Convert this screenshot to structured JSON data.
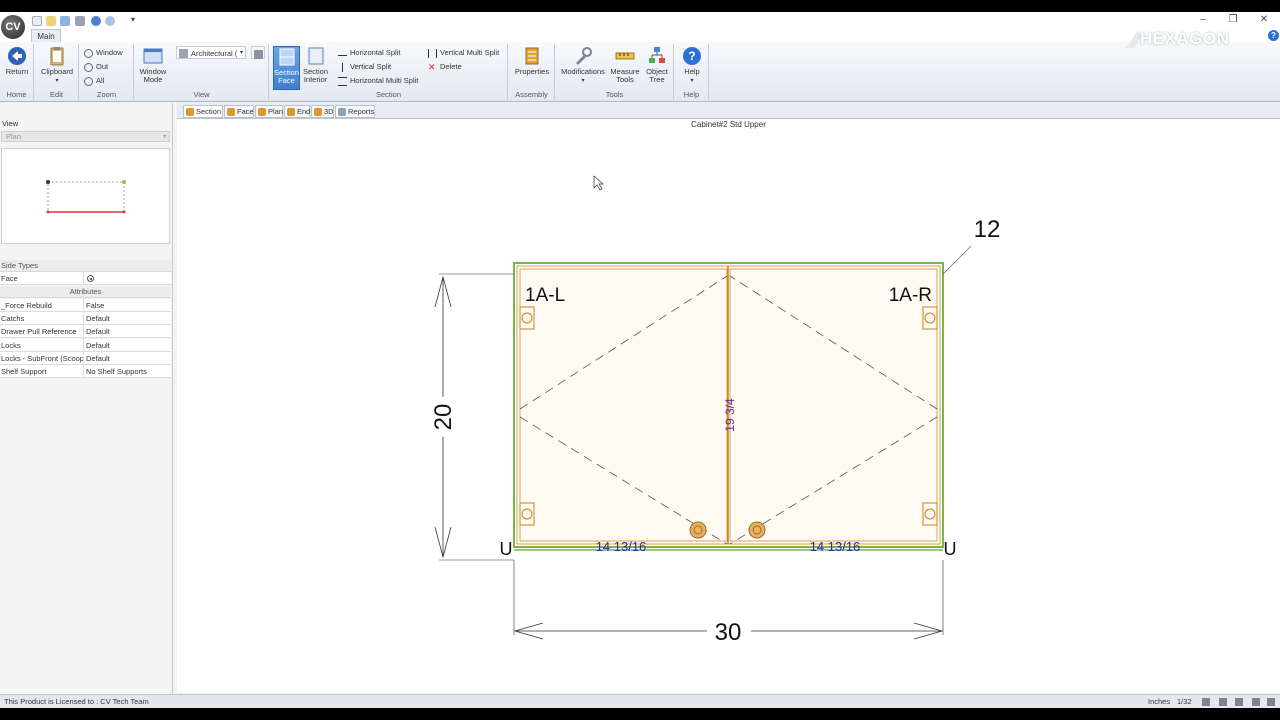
{
  "app": {
    "orb_label": "CV",
    "brand": "HEXAGON",
    "main_tab": "Main"
  },
  "ribbon": {
    "groups": {
      "home": "Home",
      "edit": "Edit",
      "zoom": "Zoom",
      "view": "View",
      "section": "Section",
      "assembly": "Assembly",
      "tools": "Tools",
      "help": "Help"
    },
    "buttons": {
      "return": "Return",
      "clipboard": "Clipboard",
      "zoom_window": "Window",
      "zoom_out": "Out",
      "zoom_all": "All",
      "window_mode_1": "Window",
      "window_mode_2": "Mode",
      "view_style": "Architectural (",
      "section_face_1": "Section",
      "section_face_2": "Face",
      "section_interior_1": "Section",
      "section_interior_2": "Interior",
      "horizontal_split": "Horizontal Split",
      "vertical_split": "Vertical Split",
      "horizontal_multi_split": "Horizontal Multi Split",
      "vertical_multi_split": "Vertical Multi Split",
      "delete": "Delete",
      "properties": "Properties",
      "modifications": "Modifications",
      "measure_tools_1": "Measure",
      "measure_tools_2": "Tools",
      "object_tree_1": "Object",
      "object_tree_2": "Tree",
      "help": "Help"
    }
  },
  "left_panel": {
    "view_label": "View",
    "view_selected": "Plan",
    "side_types_label": "Side Types",
    "face_label": "Face",
    "attributes_label": "Attributes",
    "attributes": [
      {
        "name": "_Force Rebuild",
        "value": "False"
      },
      {
        "name": "Catchs",
        "value": "Default"
      },
      {
        "name": "Drawer Pull Reference",
        "value": "Default"
      },
      {
        "name": "Locks",
        "value": "Default"
      },
      {
        "name": "Locks - SubFront (Scoop c",
        "value": "Default"
      },
      {
        "name": "Shelf Support",
        "value": "No Shelf Supports"
      }
    ]
  },
  "doc_tabs": [
    "Section",
    "Face",
    "Plan",
    "End",
    "3D",
    "Reports"
  ],
  "drawing": {
    "title": "Cabinet#2 Std Upper",
    "depth_label": "12",
    "height_label": "20",
    "width_label": "30",
    "left_door_label": "1A-L",
    "right_door_label": "1A-R",
    "left_door_width": "14 13/16",
    "right_door_width": "14 13/16",
    "door_height": "19 3/4",
    "left_u": "U",
    "right_u": "U"
  },
  "status": {
    "license": "This Product is Licensed to : CV Tech Team",
    "units": "Inches",
    "precision": "1/32"
  },
  "colors": {
    "ribbon_active": "#3f7fcf",
    "cabinet_outline_green": "#7ab648",
    "cabinet_door_orange": "#d9a04a",
    "dimension_blue": "#2a2a9a"
  }
}
